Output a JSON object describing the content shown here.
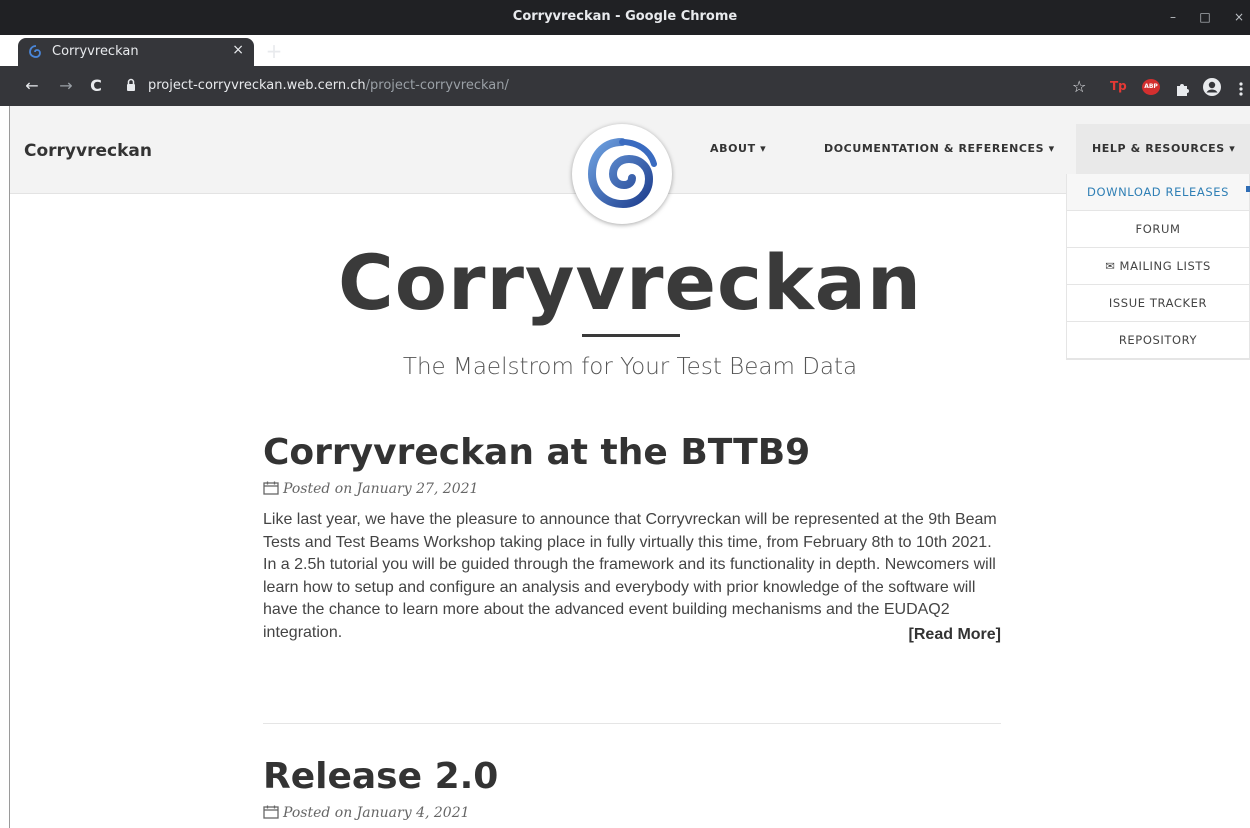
{
  "window": {
    "title": "Corryvreckan - Google Chrome",
    "controls": {
      "minimize": "–",
      "maximize": "□",
      "close": "×"
    }
  },
  "tab": {
    "label": "Corryvreckan",
    "close": "×",
    "new_tab": "+"
  },
  "toolbar": {
    "back": "←",
    "forward": "→",
    "reload": "C",
    "url_host": "project-corryvreckan.web.cern.ch",
    "url_path": "/project-corryvreckan/",
    "star": "☆",
    "extensions": [
      "Tp",
      "ABP",
      "puzzle-icon",
      "account-icon",
      "menu-icon"
    ]
  },
  "navbar": {
    "brand": "Corryvreckan",
    "items": [
      {
        "label": "ABOUT ▾"
      },
      {
        "label": "DOCUMENTATION & REFERENCES ▾"
      },
      {
        "label": "HELP & RESOURCES ▾"
      }
    ],
    "dropdown": [
      {
        "label": "DOWNLOAD RELEASES"
      },
      {
        "label": "FORUM"
      },
      {
        "label": "✉ MAILING LISTS"
      },
      {
        "label": "ISSUE TRACKER"
      },
      {
        "label": "REPOSITORY"
      }
    ]
  },
  "hero": {
    "title": "Corryvreckan",
    "subtitle": "The Maelstrom for Your Test Beam Data"
  },
  "posts": [
    {
      "title": "Corryvreckan at the BTTB9",
      "meta": "Posted on January 27, 2021",
      "body": "Like last year, we have the pleasure to announce that Corryvreckan will be represented at the 9th Beam Tests and Test Beams Workshop taking place in fully virtually this time, from February 8th to 10th 2021. In a 2.5h tutorial you will be guided through the framework and its functionality in depth. Newcomers will learn how to setup and configure an analysis and everybody with prior knowledge of the software will have the chance to learn more about the advanced event building mechanisms and the EUDAQ2 integration.",
      "read_more": "[Read More]"
    },
    {
      "title": "Release 2.0",
      "meta": "Posted on January 4, 2021"
    }
  ],
  "colors": {
    "chrome_dark": "#202124",
    "chrome_toolbar": "#35363a",
    "accent": "#2f7fb5",
    "logo_blue": "#2d5aa8"
  }
}
